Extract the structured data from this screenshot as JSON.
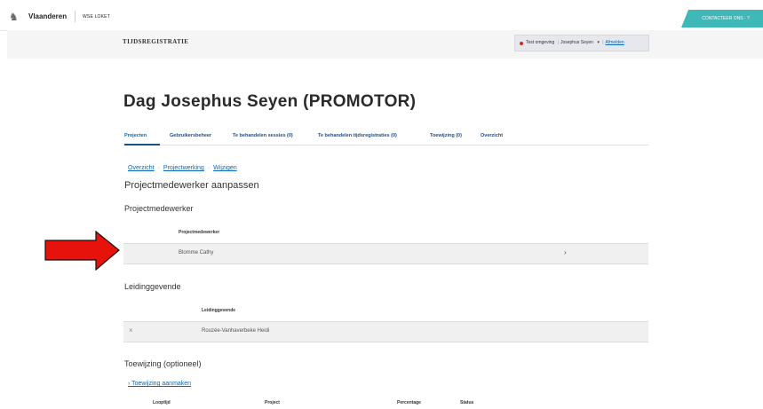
{
  "header": {
    "brand": "Vlaanderen",
    "loket": "WSE LOKET",
    "contact_label": "CONTACTEER ONS - ?"
  },
  "appbar": {
    "title": "TIJDSREGISTRATIE",
    "env_label": "Test omgeving",
    "user": "Josephus Seyen",
    "chevron": "▾",
    "logout": "Afmelden"
  },
  "page": {
    "heading": "Dag Josephus Seyen (PROMOTOR)",
    "tabs": [
      {
        "label": "Projecten"
      },
      {
        "label": "Gebruikersbeheer"
      },
      {
        "label": "Te behandelen sessies (0)"
      },
      {
        "label": "Te behandelen tijdsregistraties (0)"
      },
      {
        "label": "Toewijzing (0)"
      },
      {
        "label": "Overzicht"
      }
    ],
    "breadcrumb": [
      "Overzicht",
      "Projectwerking",
      "Wijzigen"
    ],
    "title": "Projectmedewerker aanpassen"
  },
  "projectmedewerker": {
    "section": "Projectmedewerker",
    "column": "Projectmedewerker",
    "value": "Blomme Cathy",
    "chevron": "›"
  },
  "leidinggevende": {
    "section": "Leidinggevende",
    "column": "Leidinggevende",
    "value": "Rouzée-Vanhaverbeke Heidi",
    "remove": "×"
  },
  "toewijzing": {
    "section": "Toewijzing (optioneel)",
    "add_link": "› Toewijzing aanmaken",
    "columns": [
      "Looptijd",
      "Project",
      "Percentage",
      "Status"
    ]
  },
  "colors": {
    "accent": "#3fb8b8",
    "link": "#0a66b7",
    "arrow": "#e8120c"
  }
}
